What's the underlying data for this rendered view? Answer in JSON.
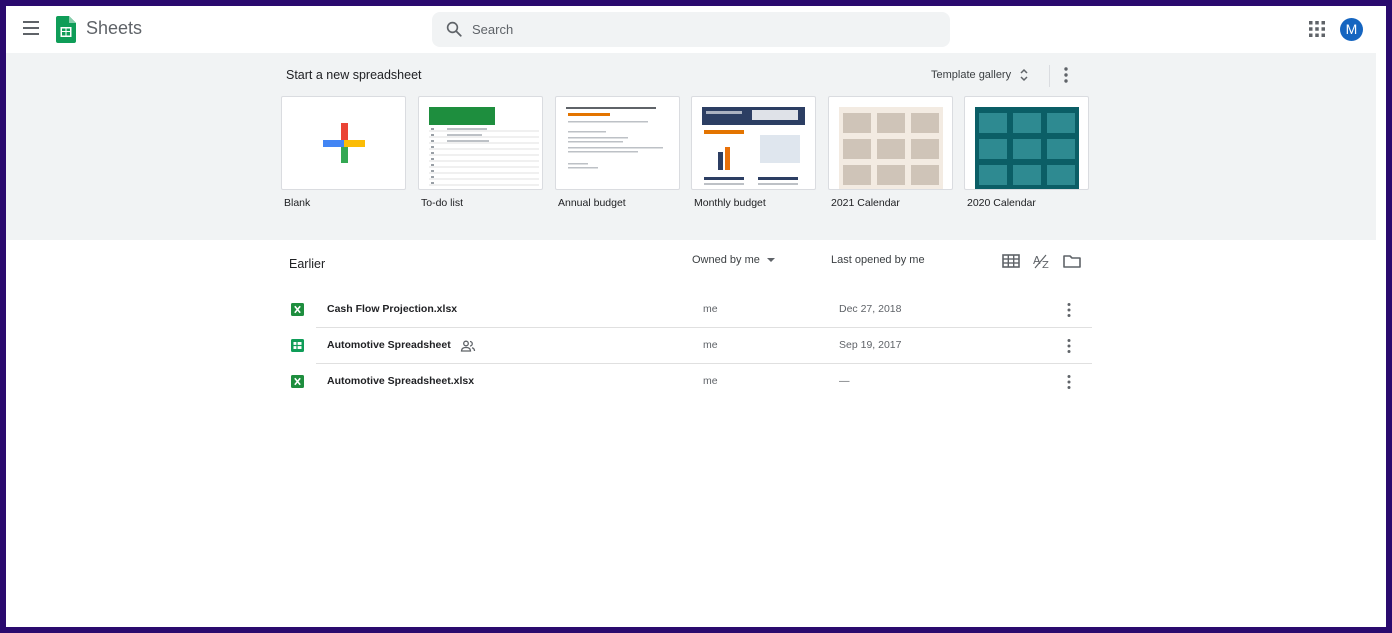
{
  "header": {
    "app_title": "Sheets",
    "search_placeholder": "Search",
    "avatar_initial": "M",
    "menu_icon": "hamburger-menu-icon",
    "apps_icon": "apps-grid-icon"
  },
  "templates": {
    "title": "Start a new spreadsheet",
    "gallery_label": "Template gallery",
    "items": [
      {
        "label": "Blank"
      },
      {
        "label": "To-do list"
      },
      {
        "label": "Annual budget"
      },
      {
        "label": "Monthly budget"
      },
      {
        "label": "2021 Calendar"
      },
      {
        "label": "2020 Calendar"
      }
    ]
  },
  "files": {
    "section_title": "Earlier",
    "owner_filter": "Owned by me",
    "sort_column": "Last opened by me",
    "rows": [
      {
        "name": "Cash Flow Projection.xlsx",
        "type": "excel",
        "shared": false,
        "owner": "me",
        "opened": "Dec 27, 2018"
      },
      {
        "name": "Automotive Spreadsheet",
        "type": "sheets",
        "shared": true,
        "owner": "me",
        "opened": "Sep 19, 2017"
      },
      {
        "name": "Automotive Spreadsheet.xlsx",
        "type": "excel",
        "shared": false,
        "owner": "me",
        "opened": "—"
      }
    ]
  },
  "colors": {
    "sheets_green": "#0f9d58",
    "excel_green": "#1e8e3e",
    "avatar_blue": "#1565c0",
    "band_bg": "#f1f3f4",
    "outer_border": "#2a0a6e"
  }
}
